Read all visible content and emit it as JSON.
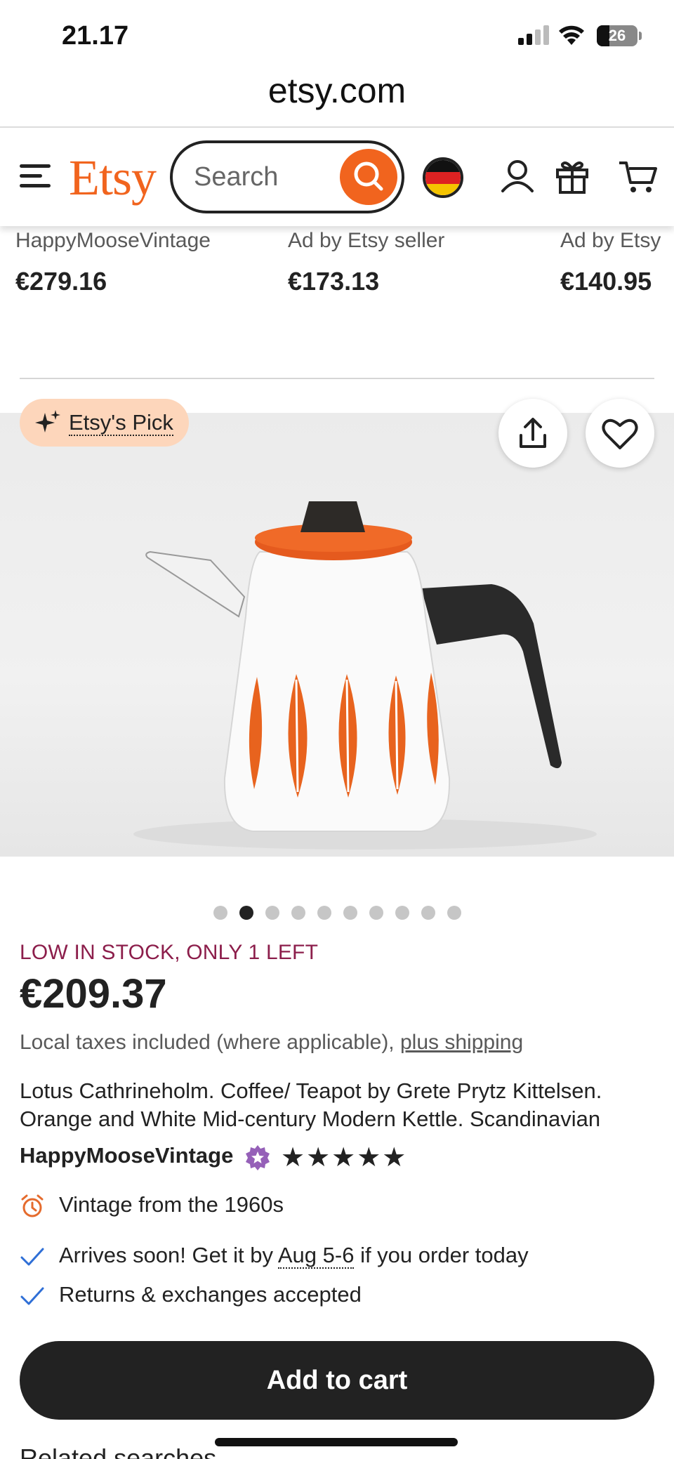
{
  "status_bar": {
    "time": "21.17",
    "battery": "26"
  },
  "browser": {
    "url": "etsy.com"
  },
  "header": {
    "logo": "Etsy",
    "search_placeholder": "Search",
    "colors": {
      "brand": "#f1641e"
    }
  },
  "recommendations": [
    {
      "seller": "HappyMooseVintage",
      "price": "€279.16"
    },
    {
      "seller": "Ad by Etsy seller",
      "price": "€173.13"
    },
    {
      "seller": "Ad by Etsy",
      "price": "€140.95"
    }
  ],
  "listing": {
    "badge": "Etsy's Pick",
    "image_count": 10,
    "active_image_index": 1,
    "stock_notice": "LOW IN STOCK, ONLY 1 LEFT",
    "price": "€209.37",
    "tax_note": "Local taxes included (where applicable),",
    "shipping_link": "plus shipping",
    "title_line1": "Lotus Cathrineholm. Coffee/ Teapot by Grete Prytz Kittelsen.",
    "title_line2": "Orange and White Mid-century Modern Kettle. Scandinavian",
    "shop_name": "HappyMooseVintage",
    "rating_stars": 5,
    "stars_text": "★★★★★",
    "features": {
      "vintage": "Vintage from the 1960s",
      "arrives_prefix": "Arrives soon! Get it by",
      "arrives_date": "Aug 5-6",
      "arrives_suffix": "if you order today",
      "returns": "Returns & exchanges accepted"
    },
    "add_to_cart": "Add to cart",
    "related_heading": "Related searches"
  },
  "colors": {
    "stock": "#8c1e4b",
    "pick_bg": "#fdd6bb",
    "button": "#222222"
  }
}
